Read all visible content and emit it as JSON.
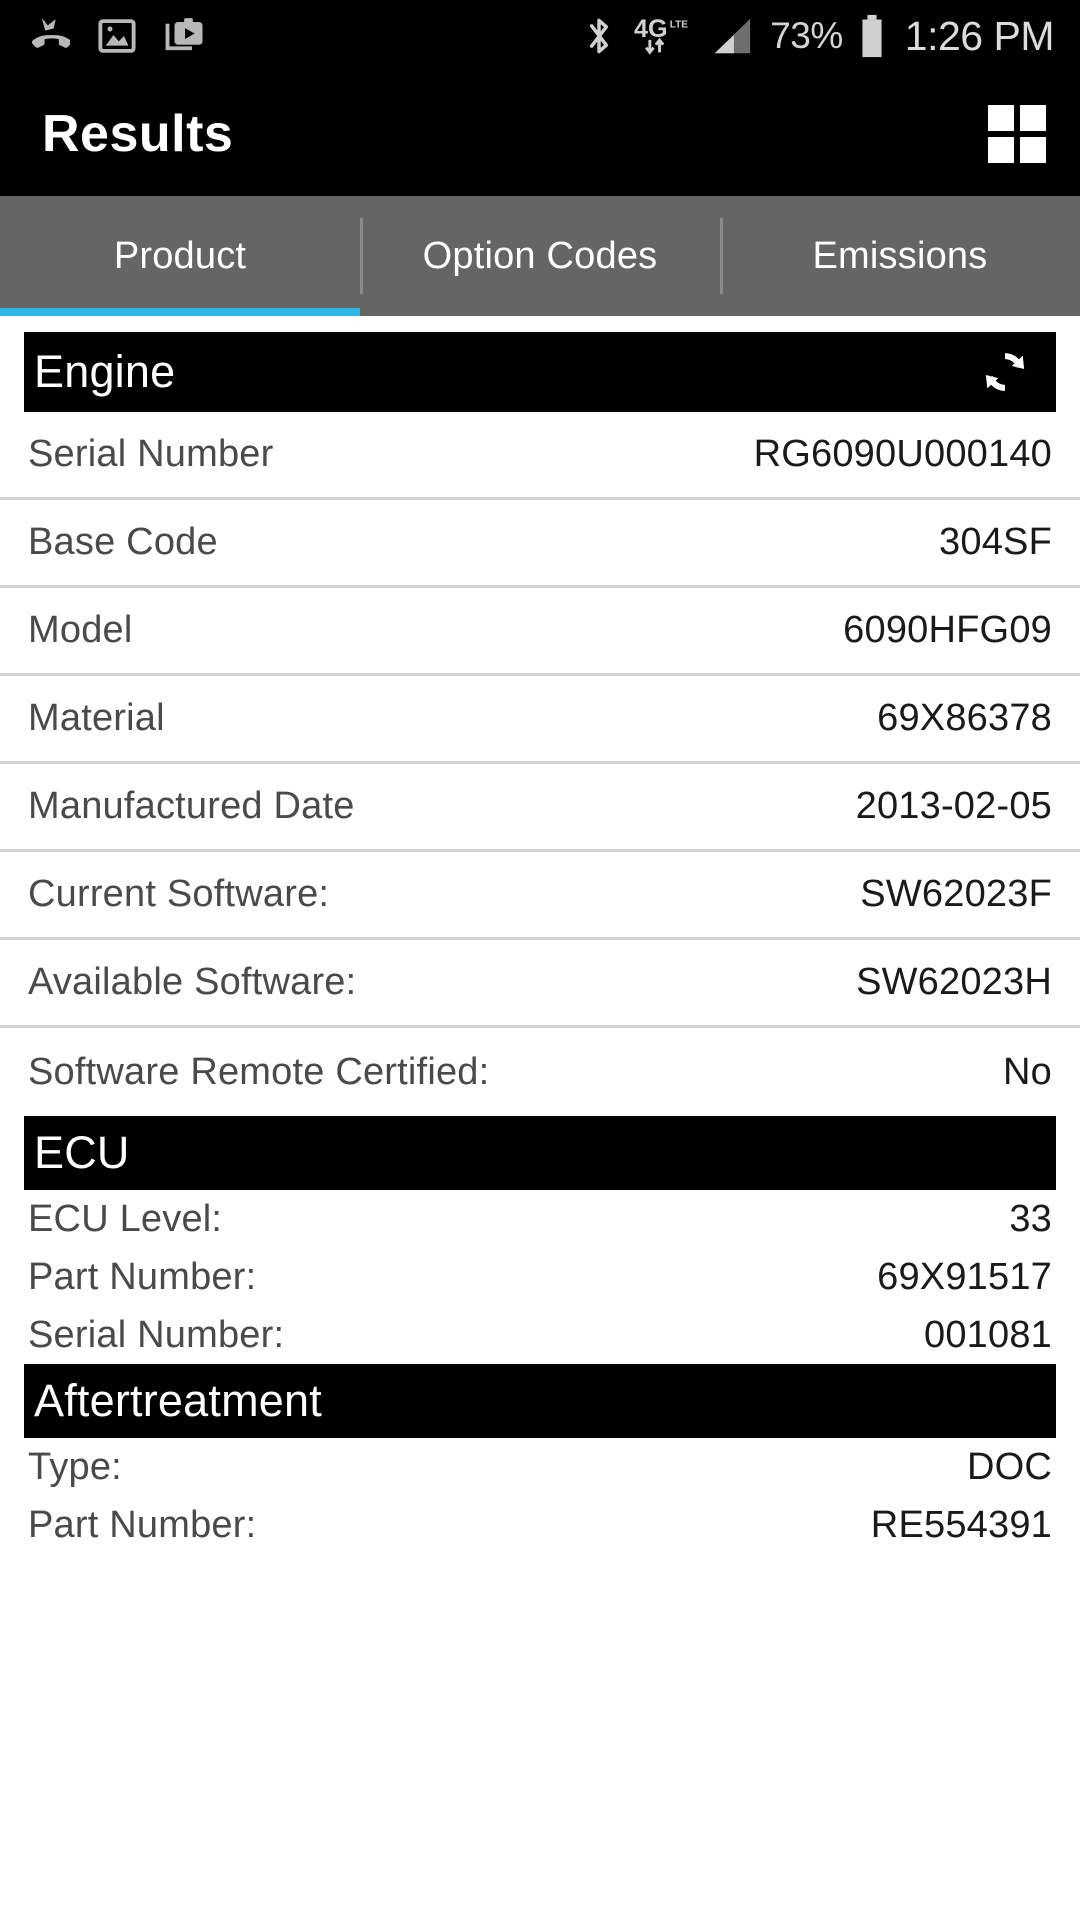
{
  "status_bar": {
    "left_icons": [
      {
        "name": "missed-call-icon",
        "label": "missed call"
      },
      {
        "name": "screenshot-icon",
        "label": "screenshot captured"
      },
      {
        "name": "media-player-icon",
        "label": "media player"
      }
    ],
    "bluetooth_icon": "bluetooth-icon",
    "network_type": "4G",
    "network_suffix": "LTE",
    "signal_icon": "signal-bars-icon",
    "battery_percent": "73%",
    "battery_icon": "battery-icon",
    "clock": "1:26 PM"
  },
  "title_bar": {
    "title": "Results",
    "grid_icon": "grid-view-icon"
  },
  "tabs": [
    {
      "label": "Product",
      "active": true
    },
    {
      "label": "Option Codes",
      "active": false
    },
    {
      "label": "Emissions",
      "active": false
    }
  ],
  "accent_color": "#2fb6e8",
  "tabbar_color": "#656565",
  "sections": [
    {
      "title": "Engine",
      "action_icon": "refresh-icon",
      "style": "spaced",
      "rows": [
        {
          "label": "Serial Number",
          "value": "RG6090U000140"
        },
        {
          "label": "Base Code",
          "value": "304SF"
        },
        {
          "label": "Model",
          "value": "6090HFG09"
        },
        {
          "label": "Material",
          "value": "69X86378"
        },
        {
          "label": "Manufactured Date",
          "value": "2013-02-05"
        },
        {
          "label": "Current Software:",
          "value": "SW62023F"
        },
        {
          "label": "Available Software:",
          "value": "SW62023H"
        },
        {
          "label": "Software Remote Certified:",
          "value": "No"
        }
      ]
    },
    {
      "title": "ECU",
      "action_icon": null,
      "style": "compact",
      "rows": [
        {
          "label": "ECU Level:",
          "value": "33"
        },
        {
          "label": "Part Number:",
          "value": "69X91517"
        },
        {
          "label": "Serial Number:",
          "value": "001081"
        }
      ]
    },
    {
      "title": "Aftertreatment",
      "action_icon": null,
      "style": "compact",
      "rows": [
        {
          "label": "Type:",
          "value": "DOC"
        },
        {
          "label": "Part Number:",
          "value": "RE554391"
        }
      ]
    }
  ]
}
